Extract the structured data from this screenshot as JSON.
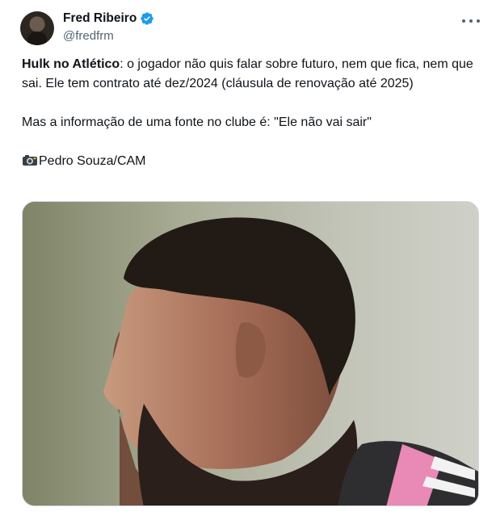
{
  "author": {
    "display_name": "Fred Ribeiro",
    "handle": "@fredfrm",
    "verified": true
  },
  "tweet": {
    "headline_bold": "Hulk no Atlético",
    "headline_rest": ": o jogador não quis falar sobre futuro, nem que fica, nem que sai. Ele tem contrato até dez/2024 (cláusula de renovação até 2025)",
    "paragraph_2": "Mas a informação de uma fonte no clube é: \"Ele não vai sair\"",
    "photo_credit": "Pedro Souza/CAM"
  },
  "icons": {
    "verified": "verified-badge-icon",
    "more": "more-options-icon",
    "camera": "camera-flash-icon"
  },
  "colors": {
    "text": "#0f1419",
    "secondary": "#536471",
    "verified": "#1d9bf0",
    "border": "#cfd9de"
  }
}
